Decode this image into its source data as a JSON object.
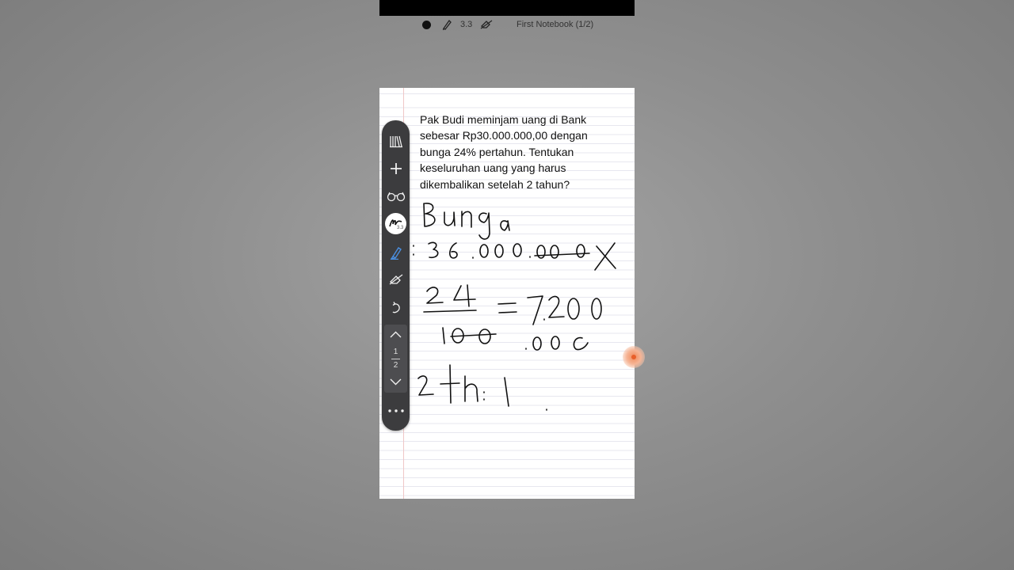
{
  "app": {
    "pen_size": "3.3",
    "notebook_title": "First Notebook (1/2)"
  },
  "page": {
    "question": "Pak Budi meminjam uang di Bank sebesar Rp30.000.000,00 dengan bunga 24% pertahun. Tentukan keseluruhan uang yang harus dikembalikan setelah 2 tahun?"
  },
  "toolbar": {
    "pen_size_label": "3.3",
    "page_current": "1",
    "page_total": "2"
  },
  "colors": {
    "background": "#8a8a8a",
    "toolbar": "#3c3c3e",
    "active_tool": "#4a8fe0",
    "handle": "#e85f2a"
  }
}
